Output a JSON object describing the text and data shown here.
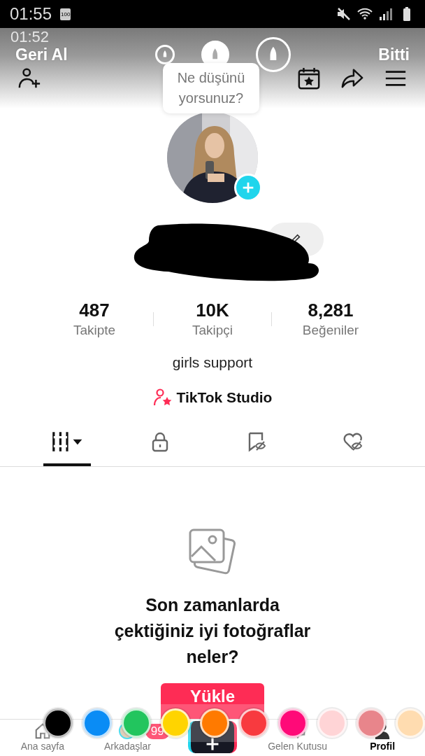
{
  "status_bar": {
    "time": "01:55",
    "battery_label": "100"
  },
  "background_status": {
    "time": "01:52"
  },
  "edit_toolbar": {
    "undo": "Geri Al",
    "done": "Bitti",
    "pen_sizes": [
      {
        "selected": false
      },
      {
        "selected": true
      },
      {
        "selected": false
      }
    ]
  },
  "tooltip": {
    "lines": [
      "Ne düşünü",
      "yorsunuz?"
    ]
  },
  "stats": [
    {
      "value": "487",
      "label": "Takipte"
    },
    {
      "value": "10K",
      "label": "Takipçi"
    },
    {
      "value": "8,281",
      "label": "Beğeniler"
    }
  ],
  "bio": "girls support",
  "studio_link": "TikTok Studio",
  "tabs": [
    {
      "kind": "grid",
      "selected": true
    },
    {
      "kind": "lock",
      "selected": false
    },
    {
      "kind": "saved-hidden",
      "selected": false
    },
    {
      "kind": "liked-hidden",
      "selected": false
    }
  ],
  "empty_state": {
    "title_lines": [
      "Son zamanlarda",
      "çektiğiniz iyi fotoğraflar",
      "neler?"
    ],
    "button": "Yükle"
  },
  "bottom_nav": [
    {
      "kind": "home",
      "label": "Ana sayfa",
      "selected": false
    },
    {
      "kind": "friends",
      "label": "Arkadaşlar",
      "badge": "99",
      "selected": false
    },
    {
      "kind": "create",
      "selected": false
    },
    {
      "kind": "inbox",
      "label": "Gelen Kutusu",
      "selected": false
    },
    {
      "kind": "profile",
      "label": "Profil",
      "selected": true
    }
  ],
  "palette": [
    {
      "color": "#000000"
    },
    {
      "color": "#0a8cf5"
    },
    {
      "color": "#22c55e"
    },
    {
      "color": "#ffd400"
    },
    {
      "color": "#ff7a00"
    },
    {
      "color": "#f83a3f"
    },
    {
      "color": "#ff0a78"
    },
    {
      "color": "#ffd4d6"
    },
    {
      "color": "#e8858b"
    },
    {
      "color": "#ffdcb0"
    }
  ]
}
